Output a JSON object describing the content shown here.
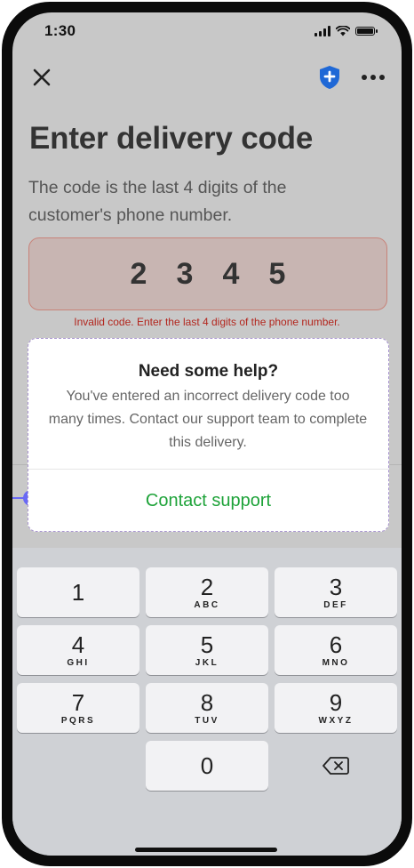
{
  "status_bar": {
    "time": "1:30"
  },
  "page": {
    "title": "Enter delivery code",
    "subtitle": "The code is the last 4 digits of the customer's phone number.",
    "code_digits": [
      "2",
      "3",
      "4",
      "5"
    ],
    "error": "Invalid code. Enter the last 4 digits of the phone number."
  },
  "dialog": {
    "title": "Need some help?",
    "body": "You've entered an incorrect delivery code too many times. Contact our support team to complete this delivery.",
    "action_label": "Contact support"
  },
  "keypad": {
    "keys": [
      {
        "num": "1",
        "letters": ""
      },
      {
        "num": "2",
        "letters": "ABC"
      },
      {
        "num": "3",
        "letters": "DEF"
      },
      {
        "num": "4",
        "letters": "GHI"
      },
      {
        "num": "5",
        "letters": "JKL"
      },
      {
        "num": "6",
        "letters": "MNO"
      },
      {
        "num": "7",
        "letters": "PQRS"
      },
      {
        "num": "8",
        "letters": "TUV"
      },
      {
        "num": "9",
        "letters": "WXYZ"
      },
      {
        "num": "0",
        "letters": ""
      }
    ]
  },
  "icons": {
    "close": "close-icon",
    "shield": "shield-icon",
    "more": "more-icon",
    "backspace": "backspace-icon"
  },
  "colors": {
    "accent_green": "#1fa33a",
    "error_red": "#b3261e",
    "shield_blue": "#1f68d6"
  }
}
